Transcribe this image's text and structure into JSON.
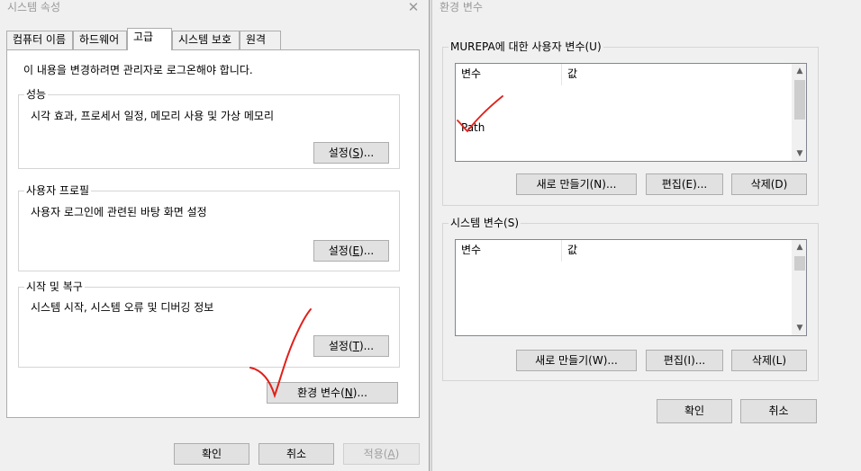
{
  "left_dialog": {
    "title": "시스템 속성",
    "tabs": [
      {
        "label": "컴퓨터 이름"
      },
      {
        "label": "하드웨어"
      },
      {
        "label": "고급"
      },
      {
        "label": "시스템 보호"
      },
      {
        "label": "원격"
      }
    ],
    "admin_note": "이 내용을 변경하려면 관리자로 로그온해야 합니다.",
    "performance": {
      "label": "성능",
      "description": "시각 효과, 프로세서 일정, 메모리 사용 및 가상 메모리",
      "button_text": "설정(",
      "button_key": "S",
      "button_tail": ")..."
    },
    "profile": {
      "label": "사용자 프로필",
      "description": "사용자 로그인에 관련된 바탕 화면 설정",
      "button_text": "설정(",
      "button_key": "E",
      "button_tail": ")..."
    },
    "startup": {
      "label": "시작 및 복구",
      "description": "시스템 시작, 시스템 오류 및 디버깅 정보",
      "button_text": "설정(",
      "button_key": "T",
      "button_tail": ")..."
    },
    "env_button": {
      "text": "환경 변수(",
      "key": "N",
      "tail": ")..."
    },
    "ok": "확인",
    "cancel": "취소",
    "apply": {
      "text": "적용(",
      "key": "A",
      "tail": ")"
    }
  },
  "right_dialog": {
    "title": "환경 변수",
    "user_group_label": "MUREPA에 대한 사용자 변수(U)",
    "user_columns": [
      "변수",
      "값"
    ],
    "user_rows": [
      {
        "name": "Path"
      }
    ],
    "user_buttons": [
      "새로 만들기(N)...",
      "편집(E)...",
      "삭제(D)"
    ],
    "system_group_label": "시스템 변수(S)",
    "system_columns": [
      "변수",
      "값"
    ],
    "system_buttons": [
      "새로 만들기(W)...",
      "편집(I)...",
      "삭제(L)"
    ],
    "ok": "확인",
    "cancel": "취소"
  },
  "icons": {
    "close": "✕",
    "scroll_up": "▲",
    "scroll_down": "▼"
  },
  "colors": {
    "annotation": "#e0201a",
    "tab_panel": "#ffffff",
    "dialog_bg": "#f0f0f0"
  }
}
